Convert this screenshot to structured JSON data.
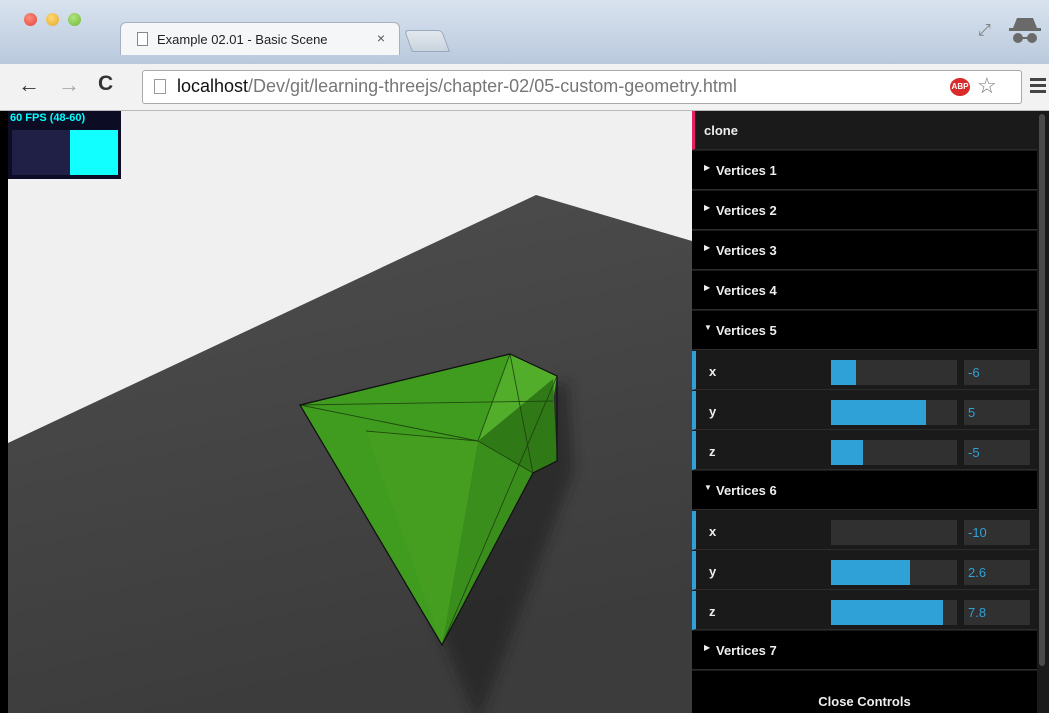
{
  "browser": {
    "tab_title": "Example 02.01 - Basic Scene",
    "tab_close": "×",
    "url_host": "localhost",
    "url_path": "/Dev/git/learning-threejs/chapter-02/05-custom-geometry.html",
    "abp_label": "ABP",
    "icons": [
      "back-arrow-icon",
      "forward-arrow-icon",
      "reload-icon",
      "page-icon",
      "adblock-icon",
      "star-icon",
      "menu-icon",
      "incognito-icon",
      "fullscreen-icon"
    ]
  },
  "stats": {
    "fps_label": "60 FPS (48-60)",
    "fps_level": 1.0
  },
  "gui": {
    "clone_label": "clone",
    "folders": {
      "v1": "Vertices 1",
      "v2": "Vertices 2",
      "v3": "Vertices 3",
      "v4": "Vertices 4",
      "v5": "Vertices 5",
      "v6": "Vertices 6",
      "v7": "Vertices 7"
    },
    "vertices5": {
      "x": {
        "label": "x",
        "value": "-6",
        "fraction": 0.2
      },
      "y": {
        "label": "y",
        "value": "5",
        "fraction": 0.75
      },
      "z": {
        "label": "z",
        "value": "-5",
        "fraction": 0.25
      }
    },
    "vertices6": {
      "x": {
        "label": "x",
        "value": "-10",
        "fraction": 0.0
      },
      "y": {
        "label": "y",
        "value": "2.6",
        "fraction": 0.63
      },
      "z": {
        "label": "z",
        "value": "7.8",
        "fraction": 0.89
      }
    },
    "close_label": "Close Controls",
    "accent_color": "#2fa1d6",
    "clone_accent": "#e61d5f"
  },
  "scene": {
    "background": "#f0f0f0",
    "plane_color": "#484848",
    "mesh_color": "#44aa22"
  }
}
